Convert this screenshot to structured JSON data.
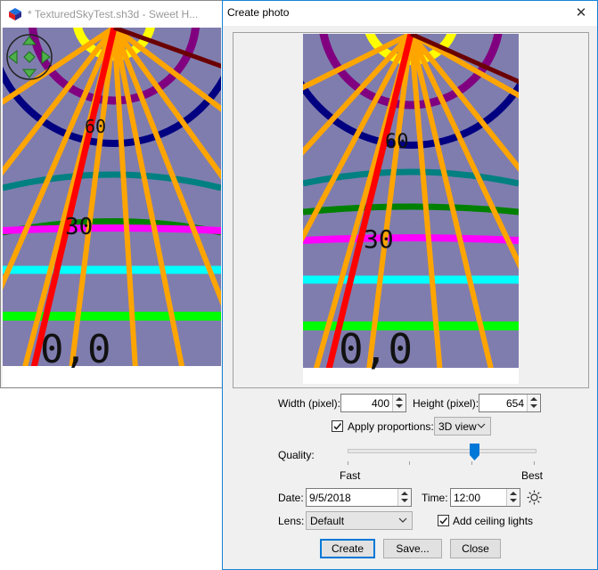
{
  "background_window": {
    "title": "* TexturedSkyTest.sh3d - Sweet H..."
  },
  "dialog": {
    "title": "Create photo",
    "close_glyph": "✕"
  },
  "size": {
    "width_label": "Width (pixel):",
    "width_value": "400",
    "height_label": "Height (pixel):",
    "height_value": "654"
  },
  "proportions": {
    "label": "Apply proportions:",
    "checked": true,
    "mode": "3D view"
  },
  "quality": {
    "label": "Quality:",
    "min_label": "Fast",
    "max_label": "Best",
    "level": 0.67
  },
  "datetime": {
    "date_label": "Date:",
    "date_value": "9/5/2018",
    "time_label": "Time:",
    "time_value": "12:00"
  },
  "lens": {
    "label": "Lens:",
    "value": "Default"
  },
  "ceiling_lights": {
    "label": "Add ceiling lights",
    "checked": true
  },
  "buttons": {
    "create": "Create",
    "save": "Save...",
    "close": "Close"
  },
  "scene_labels": {
    "deg0": "0,0",
    "deg30": "30",
    "deg60": "60"
  },
  "colors": {
    "sky": "#7f7dae",
    "rays": "#ffa500",
    "red_ray": "#ff0000",
    "dark_ray": "#6b0000",
    "ring_yellow": "#ffff00",
    "ring_purple": "#800080",
    "ring_navy": "#000080",
    "ring_teal": "#008080",
    "ring_green_dark": "#008000",
    "ring_magenta": "#ff00ff",
    "ring_cyan": "#00ffff",
    "ring_green": "#00ff00",
    "accent": "#0078d7"
  },
  "icons": {
    "app": "sweet-home-3d-icon",
    "navigator": "navigation-arrows-icon",
    "sun": "sun-icon"
  }
}
